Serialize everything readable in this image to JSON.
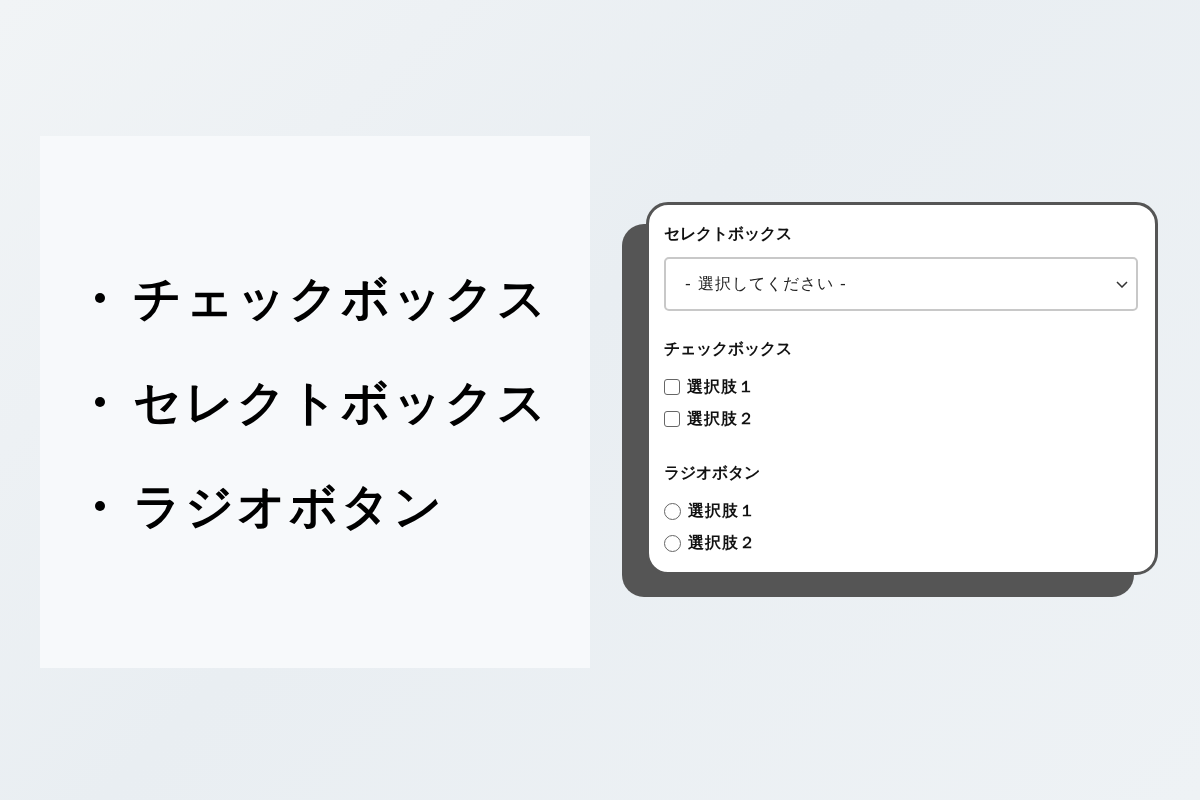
{
  "summary_list": {
    "items": [
      "チェックボックス",
      "セレクトボックス",
      "ラジオボタン"
    ]
  },
  "form": {
    "sections": [
      {
        "kind": "select",
        "label": "セレクトボックス",
        "value": "- 選択してください -"
      },
      {
        "kind": "checkbox",
        "label": "チェックボックス",
        "options": [
          {
            "label": "選択肢１",
            "checked": false
          },
          {
            "label": "選択肢２",
            "checked": false
          }
        ]
      },
      {
        "kind": "radio",
        "label": "ラジオボタン",
        "options": [
          {
            "label": "選択肢１",
            "selected": false
          },
          {
            "label": "選択肢２",
            "selected": false
          }
        ]
      }
    ]
  }
}
